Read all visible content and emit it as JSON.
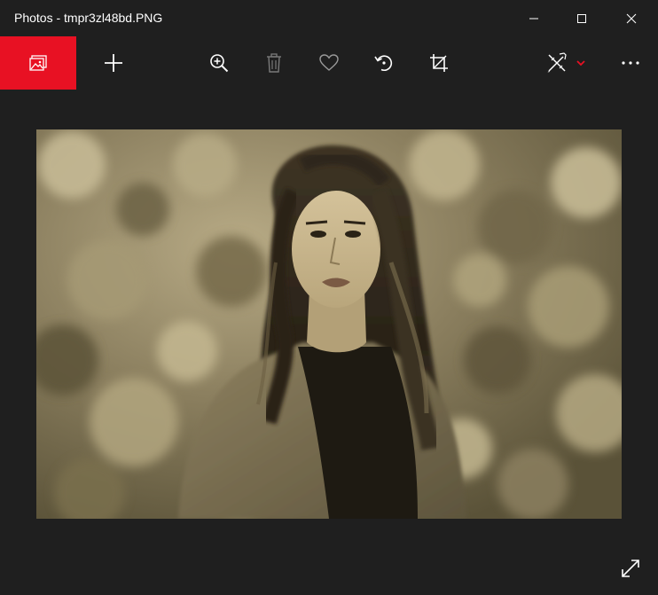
{
  "window": {
    "title": "Photos - tmpr3zl48bd.PNG"
  },
  "title_buttons": [
    {
      "name": "minimize",
      "icon": "minimize-icon"
    },
    {
      "name": "maximize",
      "icon": "maximize-icon"
    },
    {
      "name": "close",
      "icon": "close-icon"
    }
  ],
  "toolbar": {
    "items": [
      {
        "name": "collection",
        "icon": "photo-collection-icon",
        "accent": "#e81123"
      },
      {
        "name": "add",
        "icon": "plus-icon"
      },
      {
        "name": "zoom",
        "icon": "zoom-in-icon"
      },
      {
        "name": "delete",
        "icon": "trash-icon"
      },
      {
        "name": "favorite",
        "icon": "heart-icon"
      },
      {
        "name": "rotate",
        "icon": "rotate-icon"
      },
      {
        "name": "crop",
        "icon": "crop-icon"
      },
      {
        "name": "edit-create",
        "icon": "edit-create-icon"
      },
      {
        "name": "edit-dropdown",
        "icon": "chevron-down-icon",
        "accent": "#e81123"
      },
      {
        "name": "more",
        "icon": "more-icon"
      }
    ]
  },
  "viewer": {
    "photo_description_icon": "photo-image",
    "photo_tone": "sepia",
    "fullscreen_icon": "expand-icon"
  },
  "colors": {
    "background": "#1f1f1f",
    "accent": "#e81123",
    "icon": "#ffffff"
  }
}
